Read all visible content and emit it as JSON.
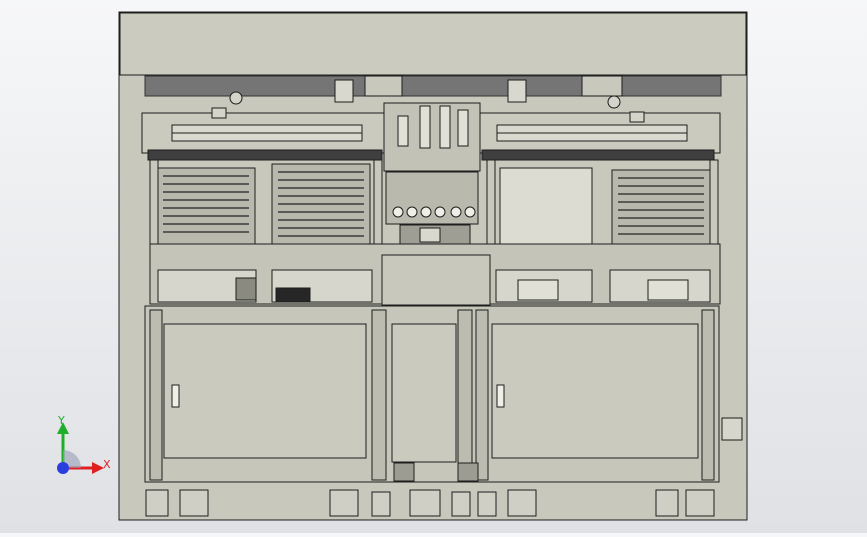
{
  "viewport": {
    "background_top": "#f6f7f8",
    "background_bottom": "#dfe1e5",
    "model_fill": "#c8c8bc",
    "model_dark": "#6e6e6e",
    "line_color": "#1e1e1e"
  },
  "triad": {
    "x_label": "X",
    "y_label": "Y",
    "x_color": "#e02020",
    "y_color": "#1fae2a",
    "z_color": "#2a3ee0"
  }
}
